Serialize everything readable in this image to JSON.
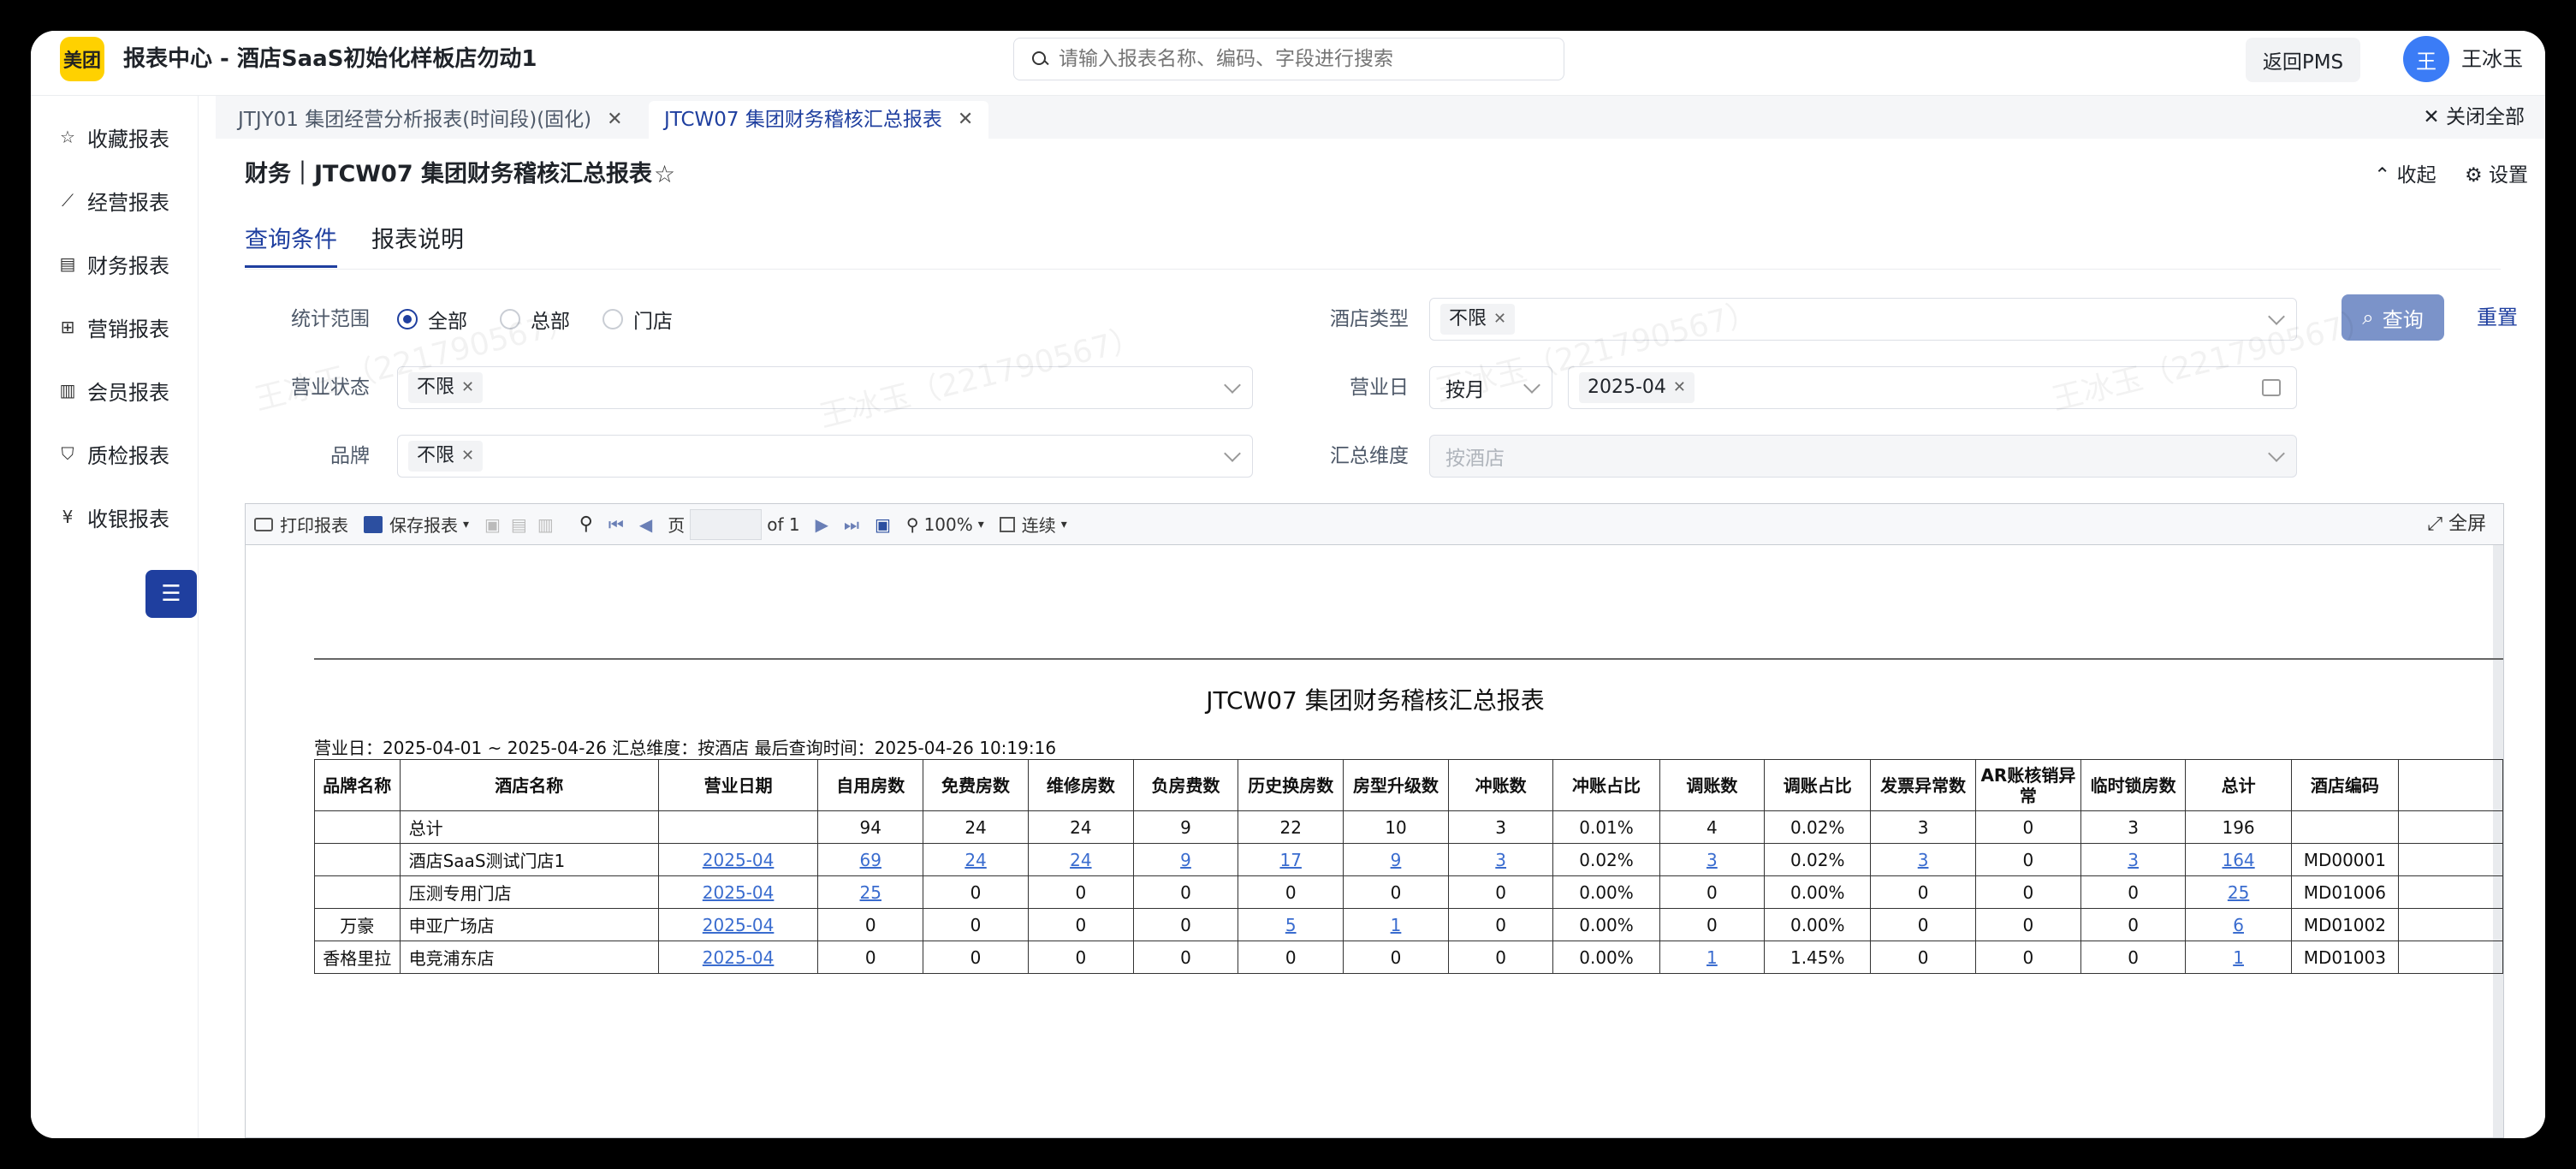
{
  "app": {
    "logo": "美团",
    "title": "报表中心 - 酒店SaaS初始化样板店勿动1",
    "back_label": "返回PMS",
    "avatar_char": "王",
    "user_name": "王冰玉"
  },
  "search": {
    "placeholder": "请输入报表名称、编码、字段进行搜索"
  },
  "sidebar": {
    "items": [
      {
        "icon": "star-icon",
        "label": "收藏报表"
      },
      {
        "icon": "line-chart-icon",
        "label": "经营报表"
      },
      {
        "icon": "receipt-icon",
        "label": "财务报表"
      },
      {
        "icon": "gift-icon",
        "label": "营销报表"
      },
      {
        "icon": "member-card-icon",
        "label": "会员报表"
      },
      {
        "icon": "shield-check-icon",
        "label": "质检报表"
      },
      {
        "icon": "yen-coin-icon",
        "label": "收银报表"
      }
    ]
  },
  "tabs": [
    {
      "label": "JTJY01 集团经营分析报表(时间段)(固化)",
      "active": false
    },
    {
      "label": "JTCW07 集团财务稽核汇总报表",
      "active": true
    }
  ],
  "close_all": "关闭全部",
  "page": {
    "title": "财务｜JTCW07 集团财务稽核汇总报表",
    "collapse": "收起",
    "settings": "设置"
  },
  "subtabs": [
    "查询条件",
    "报表说明"
  ],
  "form": {
    "scope_label": "统计范围",
    "scope_options": [
      "全部",
      "总部",
      "门店"
    ],
    "hotel_type_label": "酒店类型",
    "hotel_type_tag": "不限",
    "status_label": "营业状态",
    "status_tag": "不限",
    "bizdate_label": "营业日",
    "bizdate_mode": "按月",
    "bizdate_tag": "2025-04",
    "brand_label": "品牌",
    "brand_tag": "不限",
    "summary_label": "汇总维度",
    "summary_placeholder": "按酒店",
    "query": "查询",
    "reset": "重置"
  },
  "toolbar": {
    "print": "打印报表",
    "save": "保存报表",
    "page": "页",
    "of": "of 1",
    "zoom": "100%",
    "mode": "连续",
    "fullscreen": "全屏"
  },
  "report": {
    "title": "JTCW07 集团财务稽核汇总报表",
    "meta": "营业日：2025-04-01 ~ 2025-04-26    汇总维度：按酒店    最后查询时间：2025-04-26 10:19:16",
    "headers": [
      "品牌名称",
      "酒店名称",
      "营业日期",
      "自用房数",
      "免费房数",
      "维修房数",
      "负房费数",
      "历史换房数",
      "房型升级数",
      "冲账数",
      "冲账占比",
      "调账数",
      "调账占比",
      "发票异常数",
      "AR账核销异常",
      "临时锁房数",
      "总计",
      "酒店编码"
    ],
    "rows": [
      [
        "",
        "总计",
        "",
        "94",
        "24",
        "24",
        "9",
        "22",
        "10",
        "3",
        "0.01%",
        "4",
        "0.02%",
        "3",
        "0",
        "3",
        "196",
        ""
      ],
      [
        "",
        "酒店SaaS测试门店1",
        "2025-04",
        "69",
        "24",
        "24",
        "9",
        "17",
        "9",
        "3",
        "0.02%",
        "3",
        "0.02%",
        "3",
        "0",
        "3",
        "164",
        "MD00001"
      ],
      [
        "",
        "压测专用门店",
        "2025-04",
        "25",
        "0",
        "0",
        "0",
        "0",
        "0",
        "0",
        "0.00%",
        "0",
        "0.00%",
        "0",
        "0",
        "0",
        "25",
        "MD01006"
      ],
      [
        "万豪",
        "申亚广场店",
        "2025-04",
        "0",
        "0",
        "0",
        "0",
        "5",
        "1",
        "0",
        "0.00%",
        "0",
        "0.00%",
        "0",
        "0",
        "0",
        "6",
        "MD01002"
      ],
      [
        "香格里拉",
        "电竞浦东店",
        "2025-04",
        "0",
        "0",
        "0",
        "0",
        "0",
        "0",
        "0",
        "0.00%",
        "1",
        "1.45%",
        "0",
        "0",
        "0",
        "1",
        "MD01003"
      ]
    ],
    "links": [
      [],
      [
        2,
        3,
        4,
        5,
        6,
        7,
        8,
        9,
        11,
        13,
        15,
        16
      ],
      [
        2,
        3,
        16
      ],
      [
        2,
        7,
        8,
        16
      ],
      [
        2,
        11,
        16
      ]
    ]
  },
  "watermark": "王冰玉（221790567）"
}
